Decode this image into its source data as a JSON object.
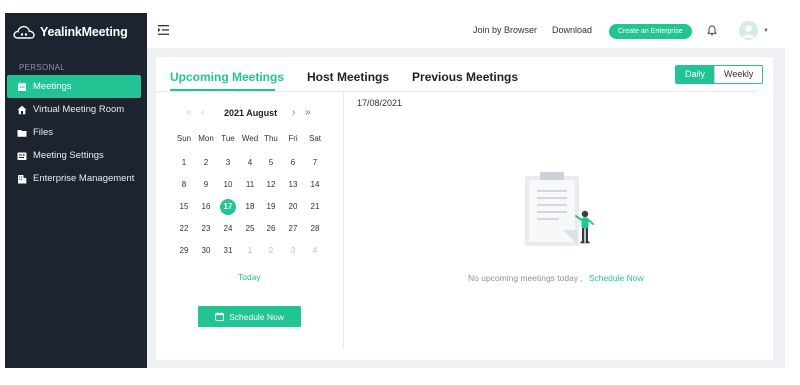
{
  "app": {
    "brand": "YealinkMeeting"
  },
  "sidebar": {
    "section": "PERSONAL",
    "items": [
      {
        "label": "Meetings",
        "icon": "calendar-icon",
        "active": true
      },
      {
        "label": "Virtual Meeting Room",
        "icon": "home-icon",
        "active": false
      },
      {
        "label": "Files",
        "icon": "folder-icon",
        "active": false
      },
      {
        "label": "Meeting Settings",
        "icon": "settings-icon",
        "active": false
      },
      {
        "label": "Enterprise Management",
        "icon": "building-icon",
        "active": false
      }
    ]
  },
  "topbar": {
    "join_label": "Join by Browser",
    "download_label": "Download",
    "create_label": "Create an Enterprise"
  },
  "tabs": [
    {
      "label": "Upcoming Meetings",
      "active": true
    },
    {
      "label": "Host Meetings",
      "active": false
    },
    {
      "label": "Previous Meetings",
      "active": false
    }
  ],
  "view_toggle": {
    "daily": "Daily",
    "weekly": "Weekly",
    "selected": "Daily"
  },
  "calendar": {
    "title": "2021 August",
    "weekdays": [
      "Sun",
      "Mon",
      "Tue",
      "Wed",
      "Thu",
      "Fri",
      "Sat"
    ],
    "weeks": [
      [
        "1",
        "2",
        "3",
        "4",
        "5",
        "6",
        "7"
      ],
      [
        "8",
        "9",
        "10",
        "11",
        "12",
        "13",
        "14"
      ],
      [
        "15",
        "16",
        "17",
        "18",
        "19",
        "20",
        "21"
      ],
      [
        "22",
        "23",
        "24",
        "25",
        "26",
        "27",
        "28"
      ],
      [
        "29",
        "30",
        "31",
        "1",
        "2",
        "3",
        "4"
      ]
    ],
    "selected_day": "17",
    "today_label": "Today",
    "schedule_label": "Schedule Now"
  },
  "agenda": {
    "date": "17/08/2021",
    "empty_message": "No upcoming meetings today ,",
    "empty_link": "Schedule Now"
  },
  "colors": {
    "accent": "#23c493",
    "sidebar_bg": "#1c2430"
  }
}
